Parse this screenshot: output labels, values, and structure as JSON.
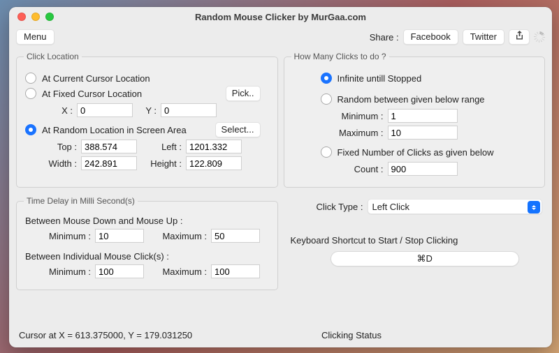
{
  "window": {
    "title": "Random Mouse Clicker by MurGaa.com"
  },
  "toolbar": {
    "menu": "Menu",
    "share_label": "Share :",
    "facebook": "Facebook",
    "twitter": "Twitter"
  },
  "click_location": {
    "legend": "Click Location",
    "opt_current": "At Current Cursor Location",
    "opt_fixed": "At Fixed Cursor Location",
    "pick": "Pick..",
    "x_label": "X :",
    "x_value": "0",
    "y_label": "Y :",
    "y_value": "0",
    "opt_random": "At Random Location in Screen Area",
    "select": "Select...",
    "top_label": "Top :",
    "top_value": "388.574",
    "left_label": "Left :",
    "left_value": "1201.332",
    "width_label": "Width :",
    "width_value": "242.891",
    "height_label": "Height :",
    "height_value": "122.809"
  },
  "time_delay": {
    "legend": "Time Delay in Milli Second(s)",
    "between_du": "Between Mouse Down and Mouse Up :",
    "du_min_label": "Minimum :",
    "du_min_value": "10",
    "du_max_label": "Maximum :",
    "du_max_value": "50",
    "between_clicks": "Between Individual Mouse Click(s) :",
    "c_min_label": "Minimum :",
    "c_min_value": "100",
    "c_max_label": "Maximum :",
    "c_max_value": "100"
  },
  "how_many": {
    "legend": "How Many Clicks to do ?",
    "opt_infinite": "Infinite untill Stopped",
    "opt_random": "Random between given below range",
    "min_label": "Minimum :",
    "min_value": "1",
    "max_label": "Maximum :",
    "max_value": "10",
    "opt_fixed": "Fixed Number of Clicks as given below",
    "count_label": "Count :",
    "count_value": "900"
  },
  "click_type": {
    "label": "Click Type :",
    "value": "Left Click"
  },
  "shortcut": {
    "label": "Keyboard Shortcut to Start / Stop Clicking",
    "value": "⌘D"
  },
  "footer": {
    "cursor": "Cursor at X = 613.375000, Y = 179.031250",
    "status": "Clicking Status"
  }
}
